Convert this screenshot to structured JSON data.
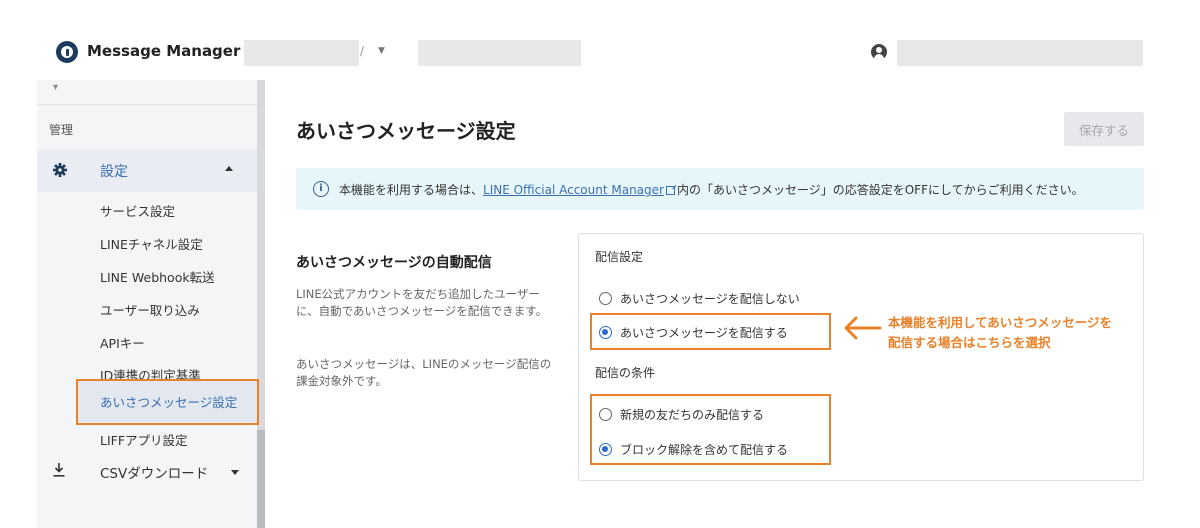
{
  "header": {
    "app_title": "Message Manager",
    "account_separator": "/"
  },
  "sidebar": {
    "group_label": "管理",
    "settings_label": "設定",
    "items": [
      {
        "label": "サービス設定"
      },
      {
        "label": "LINEチャネル設定"
      },
      {
        "label": "LINE Webhook転送"
      },
      {
        "label": "ユーザー取り込み"
      },
      {
        "label": "APIキー"
      },
      {
        "label": "ID連携の判定基準"
      },
      {
        "label": "あいさつメッセージ設定"
      },
      {
        "label": "LIFFアプリ設定"
      }
    ],
    "csv_label": "CSVダウンロード"
  },
  "main": {
    "page_title": "あいさつメッセージ設定",
    "save_label": "保存する",
    "info": {
      "prefix": "本機能を利用する場合は、",
      "link": "LINE Official Account Manager",
      "suffix": "内の「あいさつメッセージ」の応答設定をOFFにしてからご利用ください。"
    },
    "section": {
      "title": "あいさつメッセージの自動配信",
      "desc1": "LINE公式アカウントを友だち追加したユーザーに、自動であいさつメッセージを配信できます。",
      "desc2": "あいさつメッセージは、LINEのメッセージ配信の課金対象外です。"
    },
    "delivery": {
      "label": "配信設定",
      "options": [
        {
          "label": "あいさつメッセージを配信しない",
          "checked": false
        },
        {
          "label": "あいさつメッセージを配信する",
          "checked": true
        }
      ]
    },
    "condition": {
      "label": "配信の条件",
      "options": [
        {
          "label": "新規の友だちのみ配信する",
          "checked": false
        },
        {
          "label": "ブロック解除を含めて配信する",
          "checked": true
        }
      ]
    }
  },
  "annotation": {
    "line1": "本機能を利用してあいさつメッセージを",
    "line2": "配信する場合はこちらを選択"
  },
  "colors": {
    "accent": "#3a6fb0",
    "highlight": "#e8822a",
    "info_bg": "#e7f6fa",
    "radio": "#2b6bd1"
  }
}
